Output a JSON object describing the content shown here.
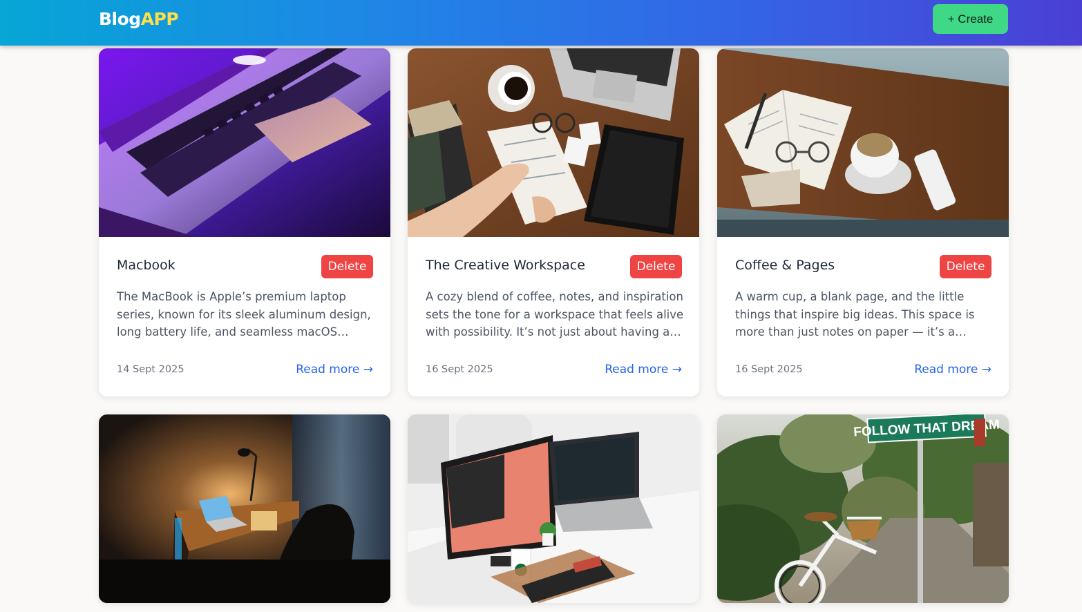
{
  "header": {
    "logo_main": "Blog",
    "logo_accent": "APP",
    "create_label": "+ Create"
  },
  "colors": {
    "header_gradient_start": "#06a6d6",
    "header_gradient_end": "#4a3fd4",
    "logo_accent": "#fde047",
    "create_button": "#3fd886",
    "delete_button": "#ef4444",
    "link": "#2563eb"
  },
  "posts": [
    {
      "title": "Macbook",
      "excerpt": "The MacBook is Apple’s premium laptop series, known for its sleek aluminum design, long battery life, and seamless macOS experience. Designed for creators and professionals alike.",
      "date": "14 Sept 2025",
      "delete_label": "Delete",
      "read_more_label": "Read more →"
    },
    {
      "title": "The Creative Workspace",
      "excerpt": "A cozy blend of coffee, notes, and inspiration sets the tone for a workspace that feels alive with possibility. It’s not just about having a desk or a place to work — it’s a mindset.",
      "date": "16 Sept 2025",
      "delete_label": "Delete",
      "read_more_label": "Read more →"
    },
    {
      "title": "Coffee & Pages",
      "excerpt": "A warm cup, a blank page, and the little things that inspire big ideas. This space is more than just notes on paper — it’s a collection of fleeting thoughts and quiet mornings.",
      "date": "16 Sept 2025",
      "delete_label": "Delete",
      "read_more_label": "Read more →"
    },
    {
      "title": ""
    },
    {
      "title": ""
    },
    {
      "title": ""
    }
  ],
  "photo_signs": {
    "street_sign": "FOLLOW THAT DREAM"
  }
}
